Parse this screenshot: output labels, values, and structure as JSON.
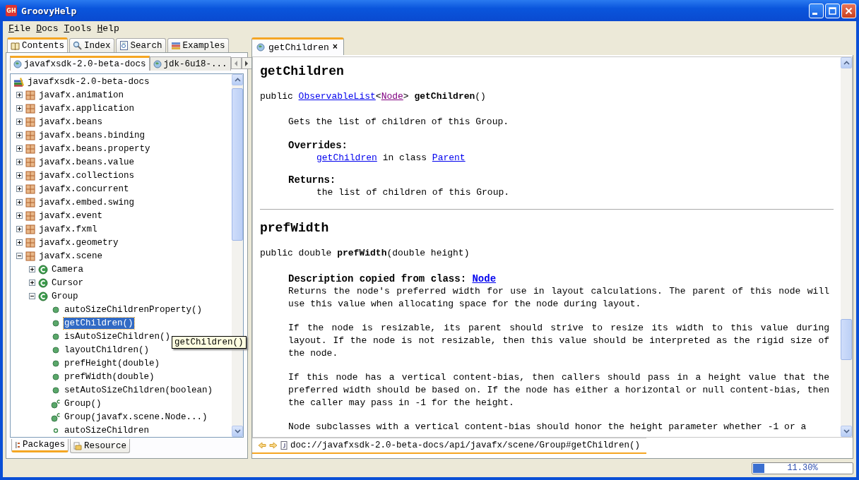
{
  "window": {
    "title": "GroovyHelp",
    "logo": "GH"
  },
  "menu": [
    {
      "label": "File"
    },
    {
      "label": "Docs"
    },
    {
      "label": "Tools"
    },
    {
      "label": "Help"
    }
  ],
  "left": {
    "tabs": [
      {
        "label": "Contents",
        "selected": true
      },
      {
        "label": "Index",
        "selected": false
      },
      {
        "label": "Search",
        "selected": false
      },
      {
        "label": "Examples",
        "selected": false
      }
    ],
    "doc_tabs": [
      {
        "label": "javafxsdk-2.0-beta-docs",
        "selected": true
      },
      {
        "label": "jdk-6u18-...",
        "selected": false
      }
    ],
    "tree": [
      {
        "label": "javafxsdk-2.0-beta-docs",
        "kind": "library",
        "selected": false,
        "children": [
          {
            "label": "javafx.animation",
            "kind": "package",
            "expanded": false,
            "selected": false
          },
          {
            "label": "javafx.application",
            "kind": "package",
            "expanded": false,
            "selected": false
          },
          {
            "label": "javafx.beans",
            "kind": "package",
            "expanded": false,
            "selected": false
          },
          {
            "label": "javafx.beans.binding",
            "kind": "package",
            "expanded": false,
            "selected": false
          },
          {
            "label": "javafx.beans.property",
            "kind": "package",
            "expanded": false,
            "selected": false
          },
          {
            "label": "javafx.beans.value",
            "kind": "package",
            "expanded": false,
            "selected": false
          },
          {
            "label": "javafx.collections",
            "kind": "package",
            "expanded": false,
            "selected": false
          },
          {
            "label": "javafx.concurrent",
            "kind": "package",
            "expanded": false,
            "selected": false
          },
          {
            "label": "javafx.embed.swing",
            "kind": "package",
            "expanded": false,
            "selected": false
          },
          {
            "label": "javafx.event",
            "kind": "package",
            "expanded": false,
            "selected": false
          },
          {
            "label": "javafx.fxml",
            "kind": "package",
            "expanded": false,
            "selected": false
          },
          {
            "label": "javafx.geometry",
            "kind": "package",
            "expanded": false,
            "selected": false
          },
          {
            "label": "javafx.scene",
            "kind": "package",
            "expanded": true,
            "selected": false,
            "children": [
              {
                "label": "Camera",
                "kind": "class",
                "expanded": false,
                "selected": false
              },
              {
                "label": "Cursor",
                "kind": "class",
                "expanded": false,
                "selected": false
              },
              {
                "label": "Group",
                "kind": "class",
                "expanded": true,
                "selected": false,
                "children": [
                  {
                    "label": "autoSizeChildrenProperty()",
                    "kind": "method",
                    "selected": false
                  },
                  {
                    "label": "getChildren()",
                    "kind": "method",
                    "selected": true
                  },
                  {
                    "label": "isAutoSizeChildren()",
                    "kind": "method",
                    "selected": false
                  },
                  {
                    "label": "layoutChildren()",
                    "kind": "method",
                    "selected": false
                  },
                  {
                    "label": "prefHeight(double)",
                    "kind": "method",
                    "selected": false
                  },
                  {
                    "label": "prefWidth(double)",
                    "kind": "method",
                    "selected": false
                  },
                  {
                    "label": "setAutoSizeChildren(boolean)",
                    "kind": "method",
                    "selected": false
                  },
                  {
                    "label": "Group()",
                    "kind": "constructor",
                    "selected": false
                  },
                  {
                    "label": "Group(javafx.scene.Node...)",
                    "kind": "constructor",
                    "selected": false
                  },
                  {
                    "label": "autoSizeChildren",
                    "kind": "field",
                    "selected": false
                  }
                ]
              }
            ]
          }
        ]
      }
    ],
    "tooltip": "getChildren()",
    "bottom_tabs": [
      {
        "label": "Packages",
        "selected": true
      },
      {
        "label": "Resource",
        "selected": false
      }
    ]
  },
  "doc": {
    "tab": {
      "label": "getChildren",
      "close": "×"
    },
    "sections": [
      {
        "heading": "getChildren",
        "signature": [
          {
            "kind": "text",
            "text": "public "
          },
          {
            "kind": "link",
            "text": "ObservableList"
          },
          {
            "kind": "text",
            "text": "<"
          },
          {
            "kind": "visited",
            "text": "Node"
          },
          {
            "kind": "text",
            "text": "> "
          },
          {
            "kind": "bold",
            "text": "getChildren"
          },
          {
            "kind": "text",
            "text": "()"
          }
        ],
        "blocks": [
          {
            "kind": "para",
            "text": "Gets the list of children of this Group."
          },
          {
            "kind": "label",
            "text": "Overrides:"
          },
          {
            "kind": "line",
            "parts": [
              {
                "kind": "link",
                "text": "getChildren"
              },
              {
                "kind": "text",
                "text": " in class "
              },
              {
                "kind": "link",
                "text": "Parent"
              }
            ]
          },
          {
            "kind": "label",
            "text": "Returns:"
          },
          {
            "kind": "line",
            "parts": [
              {
                "kind": "text",
                "text": "the list of children of this Group."
              }
            ]
          }
        ]
      },
      {
        "heading": "prefWidth",
        "signature": [
          {
            "kind": "text",
            "text": "public double "
          },
          {
            "kind": "bold",
            "text": "prefWidth"
          },
          {
            "kind": "text",
            "text": "(double height)"
          }
        ],
        "blocks": [
          {
            "kind": "copied",
            "label": "Description copied from class:",
            "link": "Node"
          },
          {
            "kind": "para",
            "text": "Returns the node's preferred width for use in layout calculations. The parent of this node will use this value when allocating space for the node during layout."
          },
          {
            "kind": "para",
            "text": "If the node is resizable, its parent should strive to resize its width to this value during layout. If the node is not resizable, then this value should be interpreted as the rigid size of the node."
          },
          {
            "kind": "para",
            "text": "If this node has a vertical content-bias, then callers should pass in a height value that the preferred width should be based on. If the node has either a horizontal or null content-bias, then the caller may pass in -1 for the height."
          },
          {
            "kind": "para",
            "text": "Node subclasses with a vertical content-bias should honor the height parameter whether -1 or a"
          }
        ]
      }
    ],
    "url": "doc://javafxsdk-2.0-beta-docs/api/javafx/scene/Group#getChildren()"
  },
  "status_bar": {
    "progress": {
      "level": 0.113,
      "reading": "11.30%"
    }
  }
}
